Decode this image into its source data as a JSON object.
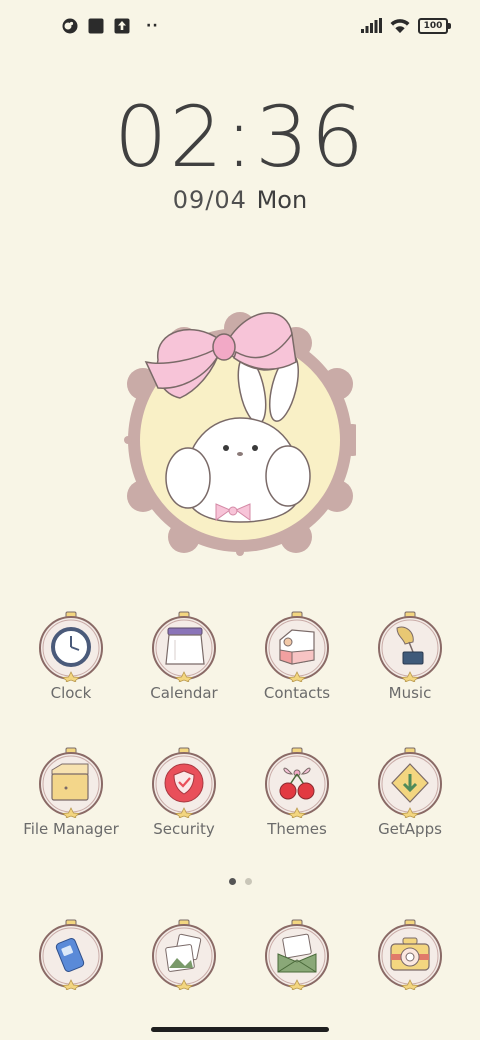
{
  "status_bar": {
    "icons_left": [
      "app-notification-icon",
      "square-notification-icon",
      "upload-icon"
    ],
    "more_indicator": "··",
    "signal": "cellular-signal-icon",
    "wifi": "wifi-icon",
    "battery": "100"
  },
  "lockscreen": {
    "time": "02:36",
    "date": "09/04",
    "weekday": "Mon"
  },
  "apps_row1": [
    {
      "label": "Clock"
    },
    {
      "label": "Calendar"
    },
    {
      "label": "Contacts"
    },
    {
      "label": "Music"
    }
  ],
  "apps_row2": [
    {
      "label": "File Manager"
    },
    {
      "label": "Security"
    },
    {
      "label": "Themes"
    },
    {
      "label": "GetApps"
    }
  ],
  "pager": {
    "pages": 2,
    "current": 1
  },
  "dock": [
    "phone-icon",
    "gallery-icon",
    "messages-icon",
    "camera-icon"
  ],
  "colors": {
    "background": "#f8f5e6",
    "icon_ring": "#a88a86",
    "icon_fill": "#f4ece7",
    "star": "#f3d680",
    "bow_pink": "#f7c4d8",
    "frame_mauve": "#c9aba7",
    "frame_inner": "#f9f0c6"
  }
}
